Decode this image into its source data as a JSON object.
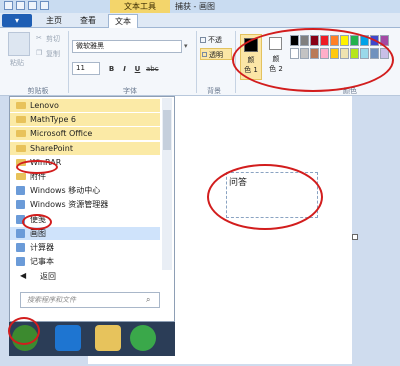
{
  "window": {
    "title": "捕获 - 画图",
    "context_tab": "文本工具"
  },
  "tabs": {
    "file": "▾",
    "home": "主页",
    "view": "查看",
    "text": "文本"
  },
  "clipboard": {
    "paste": "粘贴",
    "cut": "剪切",
    "copy": "复制",
    "group": "剪贴板"
  },
  "font": {
    "name": "微软雅黑",
    "size": "11",
    "bold": "B",
    "italic": "I",
    "underline": "U",
    "strike": "abc",
    "group": "字体"
  },
  "background": {
    "opaque": "不透明",
    "transparent": "透明",
    "group": "背景"
  },
  "colors": {
    "color1_line1": "颜",
    "color1_line2": "色 1",
    "color2_line1": "颜",
    "color2_line2": "色 2",
    "group": "颜色",
    "color1_value": "#000000",
    "color2_value": "#ffffff",
    "palette_row1": [
      "#000000",
      "#7f7f7f",
      "#880015",
      "#ed1c24",
      "#ff7f27",
      "#fff200",
      "#22b14c",
      "#00a2e8",
      "#3f48cc",
      "#a349a4"
    ],
    "palette_row2": [
      "#ffffff",
      "#c3c3c3",
      "#b97a57",
      "#ffaec9",
      "#ffc90e",
      "#efe4b0",
      "#b5e61d",
      "#99d9ea",
      "#7092be",
      "#c8bfe7"
    ]
  },
  "start_menu": {
    "items": [
      {
        "label": "Lenovo",
        "kind": "folder"
      },
      {
        "label": "MathType 6",
        "kind": "folder"
      },
      {
        "label": "Microsoft Office",
        "kind": "folder"
      },
      {
        "label": "SharePoint",
        "kind": "folder"
      },
      {
        "label": "WinRAR",
        "kind": "folder"
      },
      {
        "label": "附件",
        "kind": "folder"
      },
      {
        "label": "Windows 移动中心",
        "kind": "app"
      },
      {
        "label": "Windows 资源管理器",
        "kind": "app"
      },
      {
        "label": "便笺",
        "kind": "app"
      },
      {
        "label": "画图",
        "kind": "app"
      },
      {
        "label": "计算器",
        "kind": "app"
      },
      {
        "label": "记事本",
        "kind": "app"
      }
    ],
    "back": "返回",
    "search_placeholder": "搜索程序和文件"
  },
  "canvas": {
    "text_box": "问答"
  }
}
